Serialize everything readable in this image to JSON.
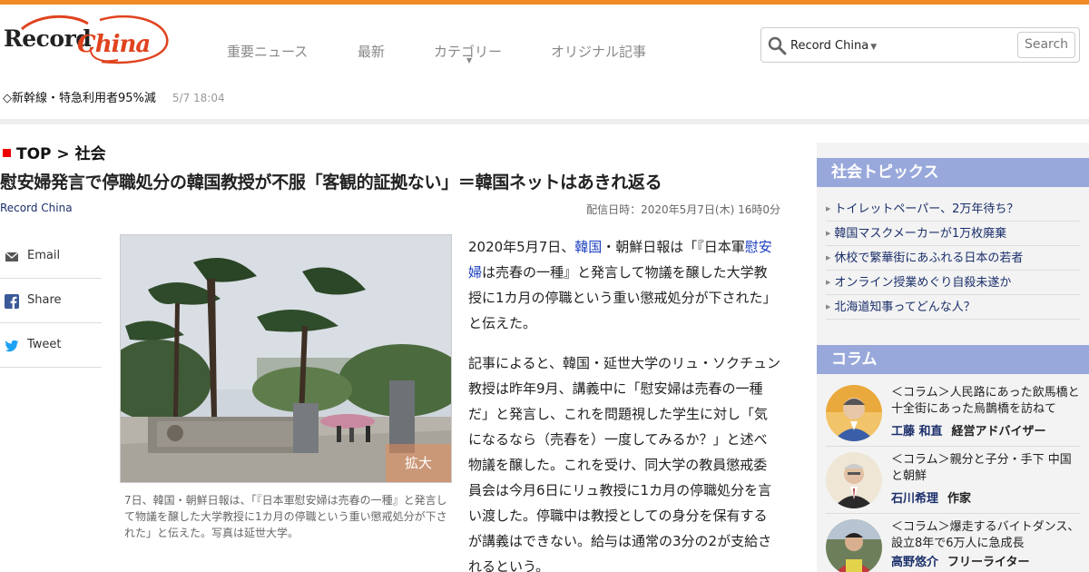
{
  "header": {
    "logo_text_1": "Record",
    "logo_text_2": "China",
    "nav": [
      "重要ニュース",
      "最新",
      "カテゴリー",
      "オリジナル記事"
    ],
    "search": {
      "scope": "Record China",
      "placeholder": "",
      "button": "Search"
    },
    "ticker": {
      "text": "◇新幹線・特急利用者95%減",
      "time": "5/7 18:04"
    }
  },
  "article": {
    "breadcrumb": "TOP > 社会",
    "title": "慰安婦発言で停職処分の韓国教授が不服「客観的証拠ない」＝韓国ネットはあきれ返る",
    "source": "Record China",
    "date": "配信日時：2020年5月7日(木) 16時0分",
    "share": [
      "Email",
      "Share",
      "Tweet"
    ],
    "zoom_label": "拡大",
    "caption": "7日、韓国・朝鮮日報は、「『日本軍慰安婦は売春の一種』と発言して物議を醸した大学教授に1カ月の停職という重い懲戒処分が下された」と伝えた。写真は延世大学。",
    "p1_a": "2020年5月7日、",
    "p1_link1": "韓国",
    "p1_b": "・朝鮮日報は「『日本軍",
    "p1_link2": "慰安婦",
    "p1_c": "は売春の一種』と発言して物議を醸した大学教授に1カ月の停職という重い懲戒処分が下された」と伝えた。",
    "p2": "記事によると、韓国・延世大学のリュ・ソクチュン教授は昨年9月、講義中に「慰安婦は売春の一種だ」と発言し、これを問題視した学生に対し「気になるなら（売春を）一度してみるか？」と述べ物議を醸した。これを受け、同大学の教員懲戒委員会は今月6日にリュ教授に1カ月の停職処分を言い渡した。停職中は教授としての身分を保有するが講義はできない。給与は通常の3分の2が支給されるという。"
  },
  "sidebar": {
    "topics_title": "社会トピックス",
    "topics": [
      "トイレットペーパー、2万年待ち？",
      "韓国マスクメーカーが1万枚廃棄",
      "休校で繁華街にあふれる日本の若者",
      "オンライン授業めぐり自殺未遂か",
      "北海道知事ってどんな人？"
    ],
    "column_title": "コラム",
    "columns": [
      {
        "title": "＜コラム＞人民路にあった飲馬橋と十全街にあった烏鵲橋を訪ねて",
        "name": "工藤 和直",
        "role": "経営アドバイザー"
      },
      {
        "title": "＜コラム＞親分と子分・手下 中国と朝鮮",
        "name": "石川希理",
        "role": "作家"
      },
      {
        "title": "＜コラム＞爆走するバイトダンス、設立8年で6万人に急成長",
        "name": "高野悠介",
        "role": "フリーライター"
      }
    ]
  },
  "colors": {
    "accent": "#f08a24",
    "side_header": "#99a8da",
    "link": "#1a3dbf",
    "logo_red": "#e0431e"
  }
}
